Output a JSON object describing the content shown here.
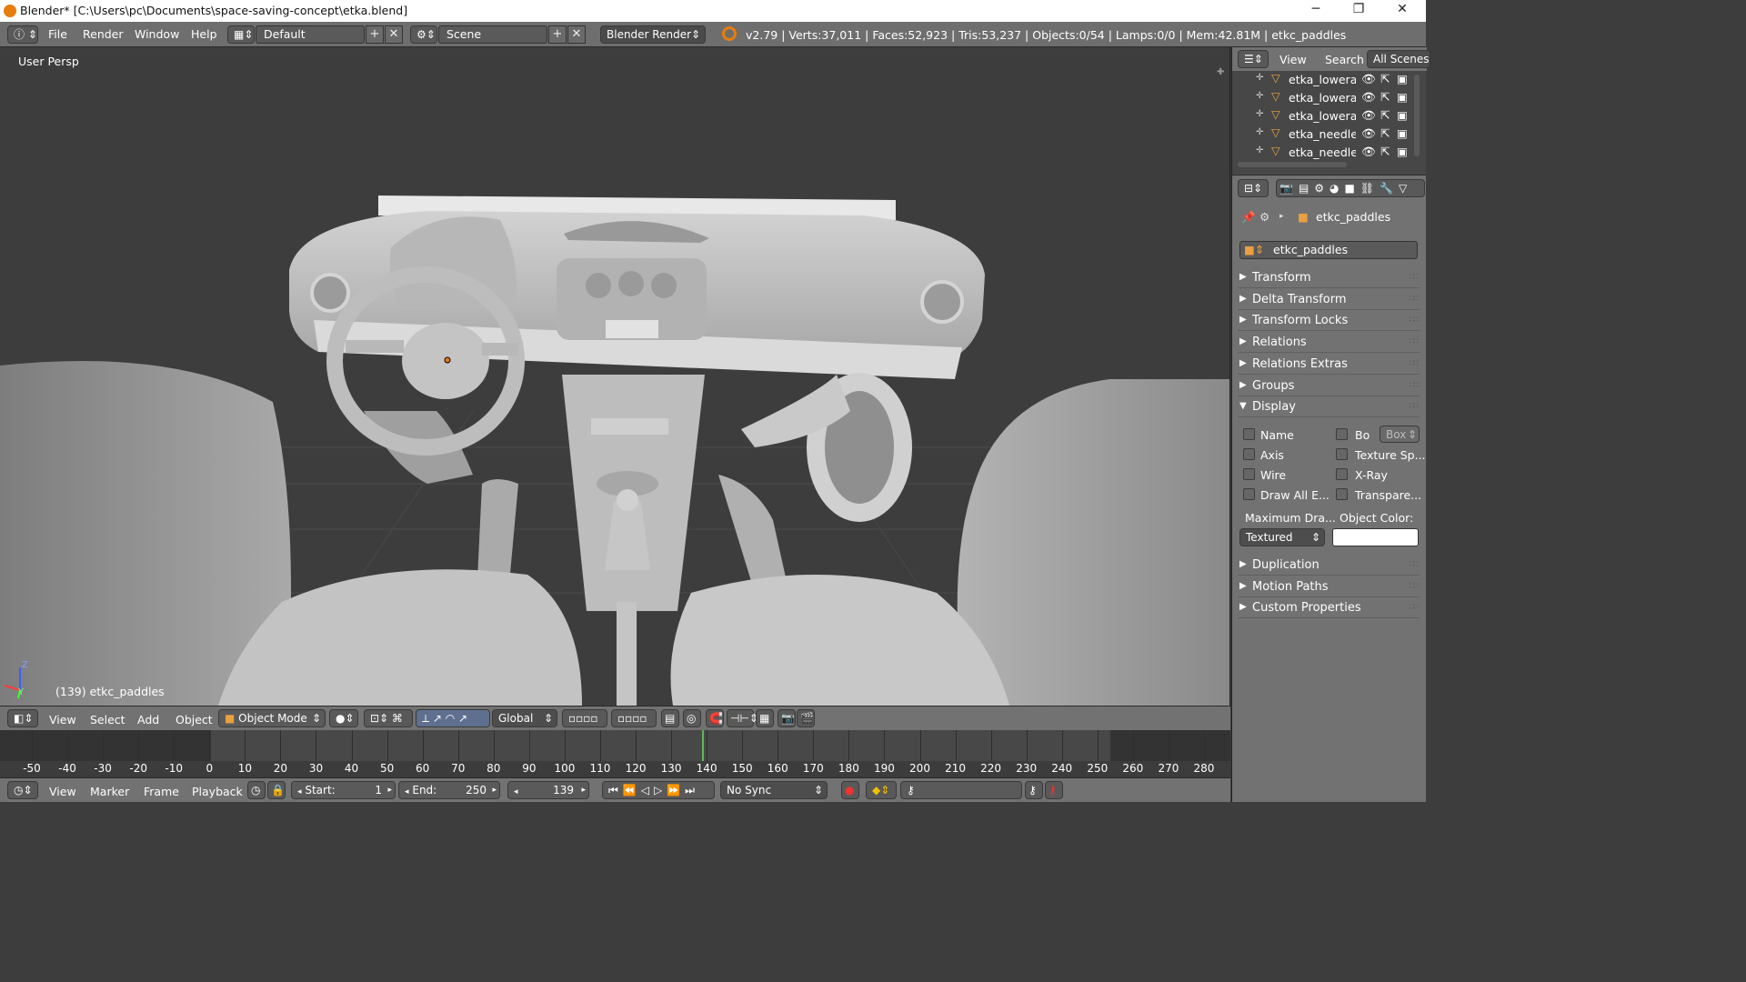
{
  "window": {
    "title": "Blender* [C:\\Users\\pc\\Documents\\space-saving-concept\\etka.blend]",
    "minimize": "─",
    "restore": "❐",
    "close": "✕"
  },
  "info_header": {
    "menus": [
      "File",
      "Render",
      "Window",
      "Help"
    ],
    "screen_layout": "Default",
    "scene": "Scene",
    "render_engine": "Blender Render",
    "stats": "v2.79 | Verts:37,011 | Faces:52,923 | Tris:53,237 | Objects:0/54 | Lamps:0/0 | Mem:42.81M | etkc_paddles"
  },
  "viewport": {
    "view_label": "User Persp",
    "object_label": "(139) etkc_paddles",
    "axis_z": "Z",
    "axis_y": "Y"
  },
  "viewport_header": {
    "menus": [
      "View",
      "Select",
      "Add",
      "Object"
    ],
    "mode": "Object Mode",
    "orientation": "Global"
  },
  "timeline": {
    "ticks": [
      "-50",
      "-40",
      "-30",
      "-20",
      "-10",
      "0",
      "10",
      "20",
      "30",
      "40",
      "50",
      "60",
      "70",
      "80",
      "90",
      "100",
      "110",
      "120",
      "130",
      "140",
      "150",
      "160",
      "170",
      "180",
      "190",
      "200",
      "210",
      "220",
      "230",
      "240",
      "250",
      "260",
      "270",
      "280"
    ],
    "current_frame": 139,
    "menus": [
      "View",
      "Marker",
      "Frame",
      "Playback"
    ],
    "start_label": "Start:",
    "start_value": "1",
    "end_label": "End:",
    "end_value": "250",
    "frame_value": "139",
    "sync": "No Sync"
  },
  "outliner": {
    "menus": [
      "View",
      "Search"
    ],
    "filter": "All Scenes",
    "items": [
      "etka_lowerarm",
      "etka_lowerarm",
      "etka_lowerarm",
      "etka_needle_",
      "etka_needle_"
    ]
  },
  "properties": {
    "breadcrumb": "etkc_paddles",
    "object_name": "etkc_paddles",
    "panels_top": [
      "Transform",
      "Delta Transform",
      "Transform Locks",
      "Relations",
      "Relations Extras",
      "Groups"
    ],
    "display_panel": "Display",
    "display_checks_left": [
      "Name",
      "Axis",
      "Wire",
      "Draw All E..."
    ],
    "display_checks_right": [
      "Bo",
      "Texture Sp...",
      "X-Ray",
      "Transpare..."
    ],
    "bounds_type": "Box",
    "max_draw_label": "Maximum Dra...",
    "object_color_label": "Object Color:",
    "max_draw_value": "Textured",
    "panels_bottom": [
      "Duplication",
      "Motion Paths",
      "Custom Properties"
    ],
    "colors": {
      "accent": "#e87d0d",
      "frame_marker": "#5cb85c",
      "header": "#727272",
      "viewport": "#3d3d3d"
    }
  }
}
